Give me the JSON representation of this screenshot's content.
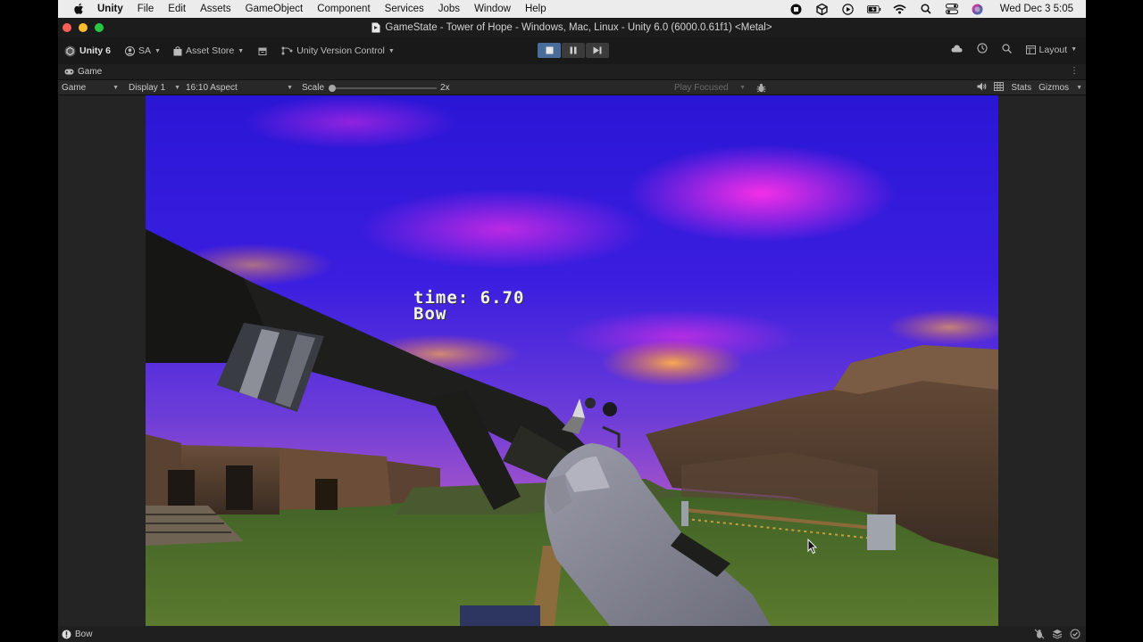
{
  "menubar": {
    "app_name": "Unity",
    "items": [
      "File",
      "Edit",
      "Assets",
      "GameObject",
      "Component",
      "Services",
      "Jobs",
      "Window",
      "Help"
    ],
    "clock": "Wed Dec 3  5:05"
  },
  "window": {
    "title": "GameState - Tower of Hope - Windows, Mac, Linux - Unity 6.0 (6000.0.61f1) <Metal>"
  },
  "toolbar": {
    "unity_label": "Unity 6",
    "account_label": "SA",
    "asset_store_label": "Asset Store",
    "version_control_label": "Unity Version Control",
    "layout_label": "Layout"
  },
  "tab": {
    "label": "Game"
  },
  "game_view": {
    "view_mode": "Game",
    "display": "Display 1",
    "aspect": "16:10 Aspect",
    "scale_label": "Scale",
    "scale_value": "2x",
    "play_mode": "Play Focused",
    "stats_label": "Stats",
    "gizmos_label": "Gizmos"
  },
  "hud": {
    "timer_text": "time: 6.70",
    "weapon_text": "Bow"
  },
  "status": {
    "message": "Bow"
  },
  "colors": {
    "accent_play": "#4a6c9a",
    "sky_top": "#2a10d0",
    "sky_magenta": "#e030e0",
    "grass": "#4a6e2a"
  }
}
